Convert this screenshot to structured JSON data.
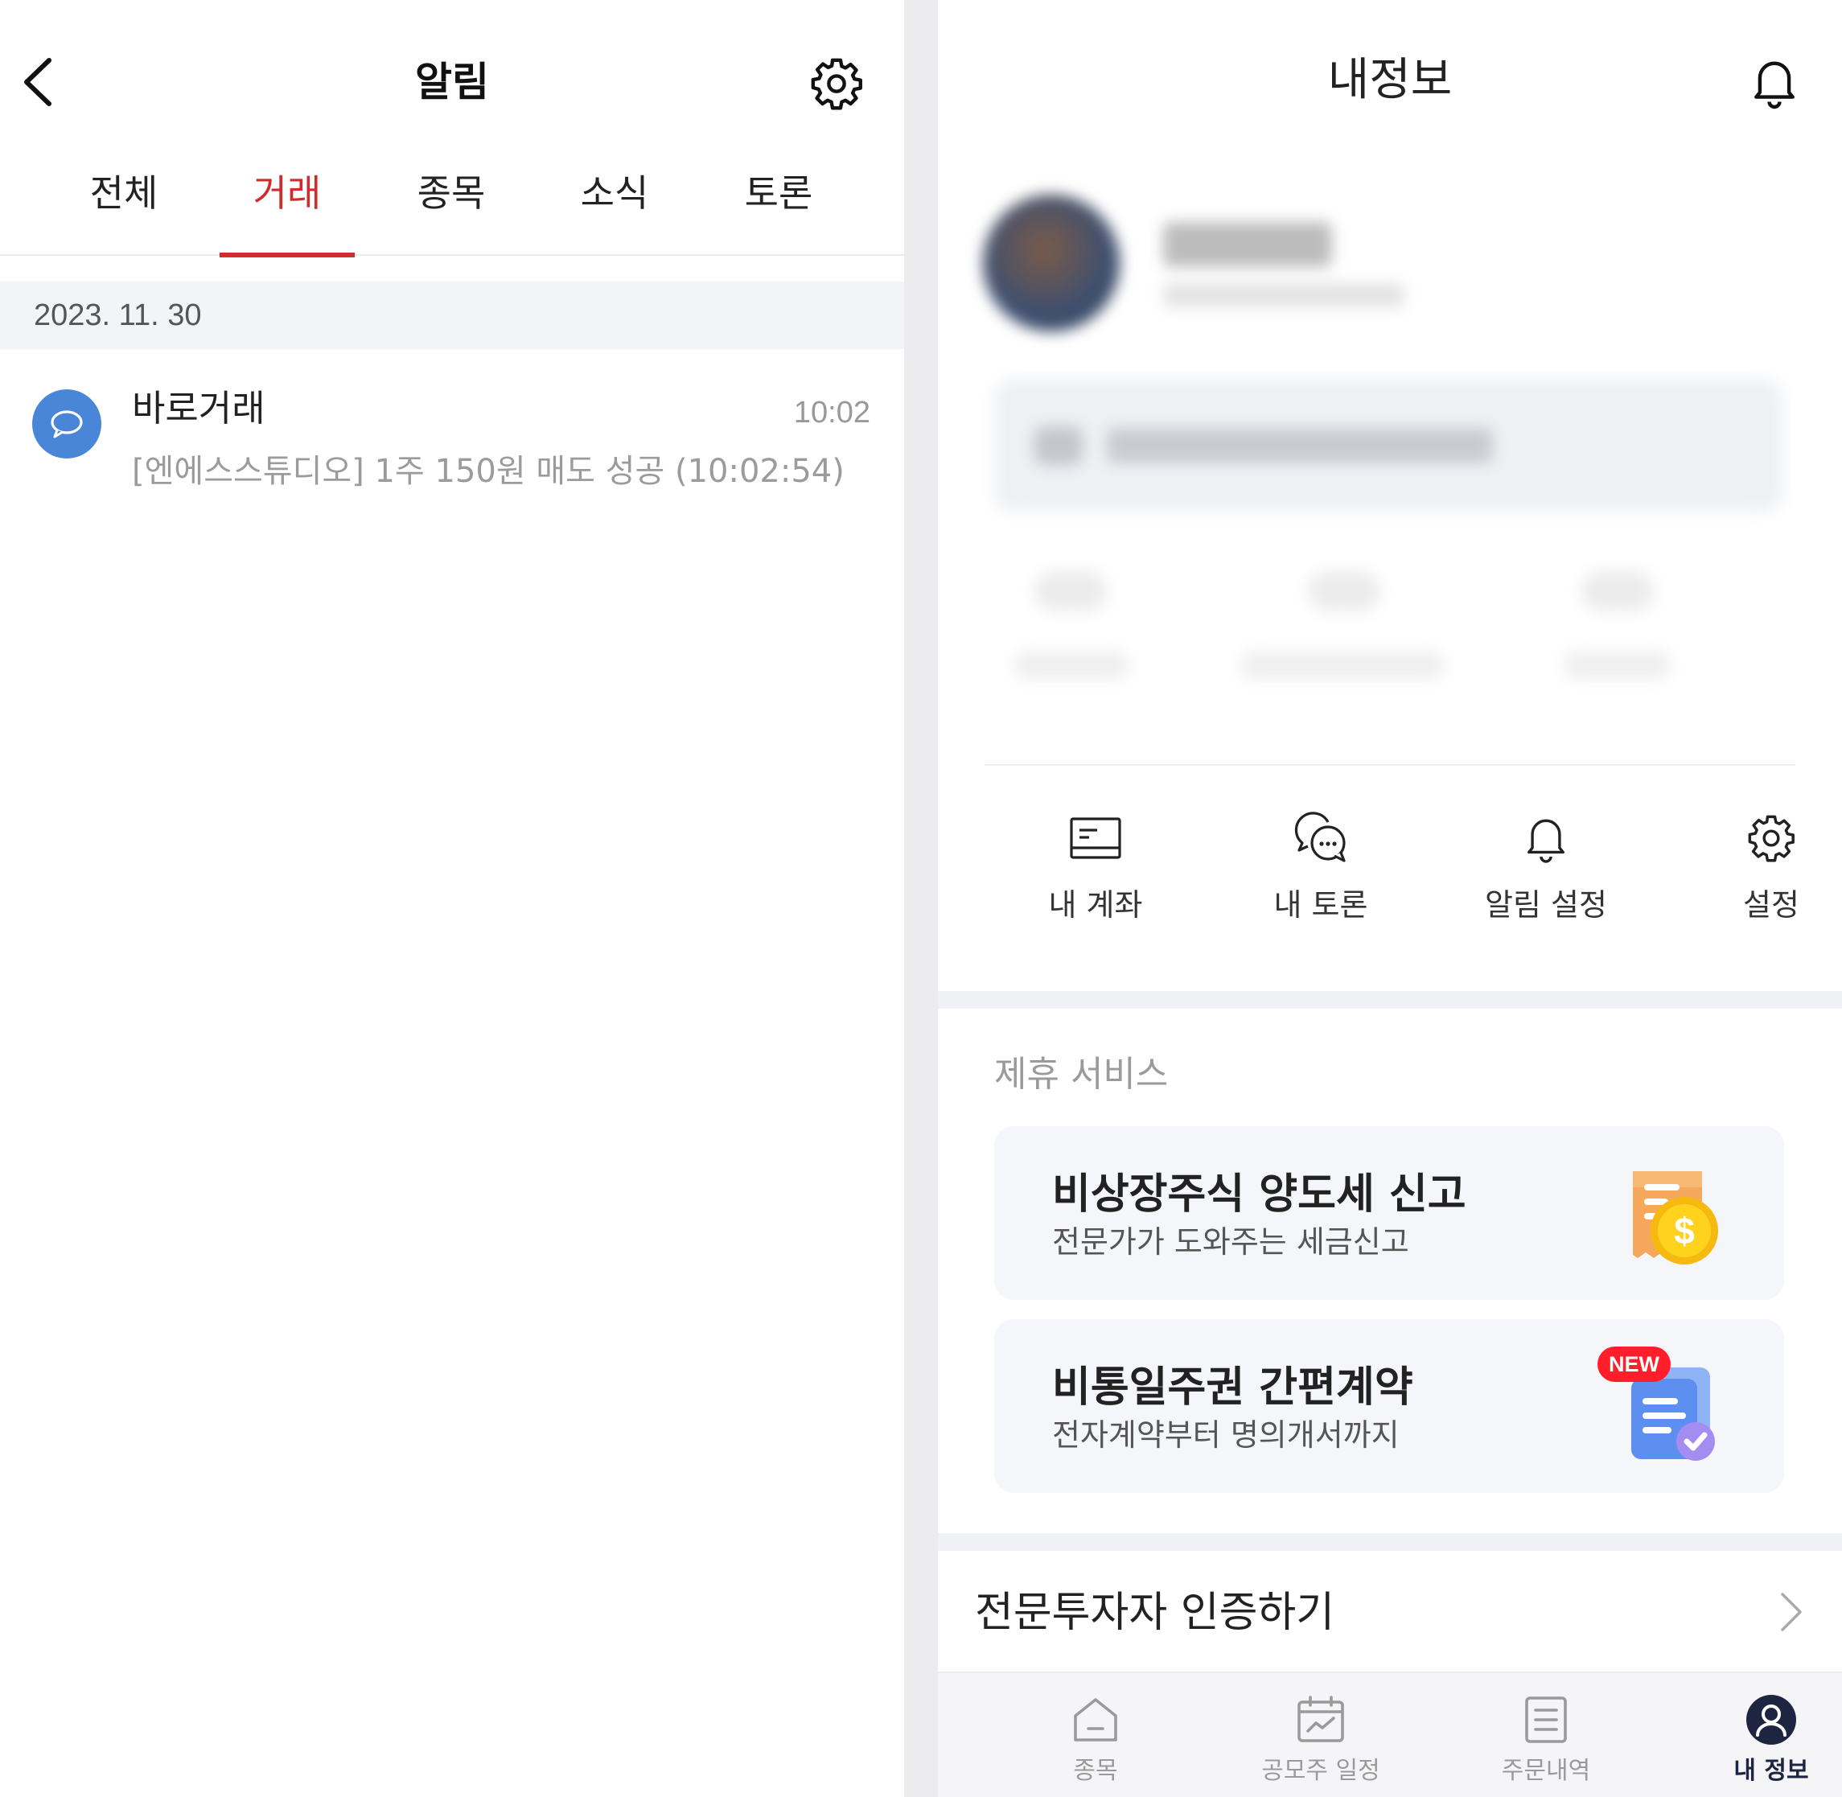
{
  "left": {
    "title": "알림",
    "tabs": [
      {
        "label": "전체",
        "active": false
      },
      {
        "label": "거래",
        "active": true
      },
      {
        "label": "종목",
        "active": false
      },
      {
        "label": "소식",
        "active": false
      },
      {
        "label": "토론",
        "active": false
      }
    ],
    "date": "2023. 11. 30",
    "notification": {
      "title": "바로거래",
      "time": "10:02",
      "message": "[엔에스스튜디오] 1주 150원 매도 성공 (10:02:54)",
      "icon": "chat-bubble-icon"
    },
    "icons": {
      "back": "chevron-left-icon",
      "settings": "gear-icon"
    },
    "colors": {
      "accent": "#d22b2b",
      "avatar": "#4a86d8"
    }
  },
  "right": {
    "title": "내정보",
    "quick_menu": [
      {
        "label": "내 계좌",
        "icon": "account-card-icon"
      },
      {
        "label": "내 토론",
        "icon": "discussion-bubbles-icon"
      },
      {
        "label": "알림 설정",
        "icon": "bell-icon"
      },
      {
        "label": "설정",
        "icon": "gear-icon"
      }
    ],
    "affiliate": {
      "section_title": "제휴 서비스",
      "cards": [
        {
          "title": "비상장주식 양도세 신고",
          "subtitle": "전문가가 도와주는 세금신고",
          "icon": "tax-receipt-coin-icon"
        },
        {
          "title": "비통일주권 간편계약",
          "subtitle": "전자계약부터 명의개서까지",
          "badge": "NEW",
          "icon": "contract-check-icon"
        }
      ]
    },
    "pro_investor": {
      "label": "전문투자자 인증하기"
    },
    "bottom_nav": [
      {
        "label": "종목",
        "icon": "home-icon",
        "active": false
      },
      {
        "label": "공모주 일정",
        "icon": "calendar-chart-icon",
        "active": false
      },
      {
        "label": "주문내역",
        "icon": "order-list-icon",
        "active": false
      },
      {
        "label": "내 정보",
        "icon": "profile-icon",
        "active": true
      }
    ]
  }
}
